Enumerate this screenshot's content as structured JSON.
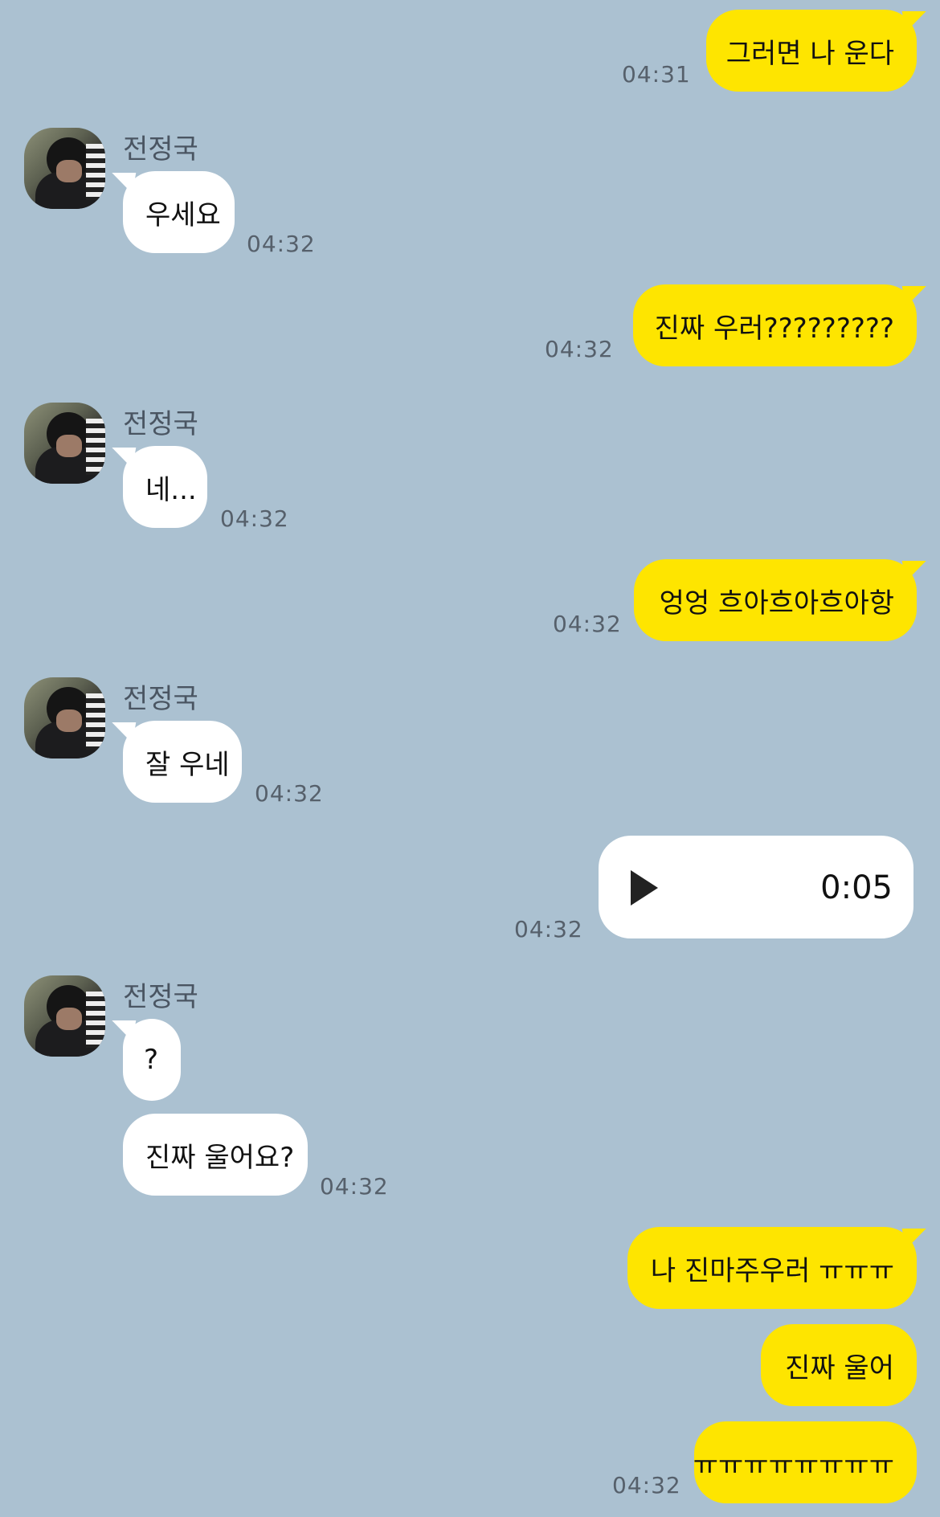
{
  "contact": {
    "name": "전정국"
  },
  "messages": {
    "m1": {
      "text": "그러면 나 운다",
      "time": "04:31"
    },
    "m2": {
      "text": "우세요",
      "time": "04:32"
    },
    "m3": {
      "text": "진짜 우러?????????",
      "time": "04:32"
    },
    "m4": {
      "text": "네...",
      "time": "04:32"
    },
    "m5": {
      "text": "엉엉 흐아흐아흐아항",
      "time": "04:32"
    },
    "m6": {
      "text": "잘 우네",
      "time": "04:32"
    },
    "m7": {
      "duration": "0:05",
      "time": "04:32"
    },
    "m8": {
      "text": "?"
    },
    "m9": {
      "text": "진짜 울어요?",
      "time": "04:32"
    },
    "m10": {
      "text": "나 진마주우러 ㅠㅠㅠ"
    },
    "m11": {
      "text": "진짜 울어"
    },
    "m12": {
      "text": "ㅠㅠㅠㅠㅠㅠㅠㅠ",
      "time": "04:32"
    }
  },
  "colors": {
    "background": "#abc1d1",
    "outgoing": "#fee500",
    "incoming": "#ffffff"
  }
}
